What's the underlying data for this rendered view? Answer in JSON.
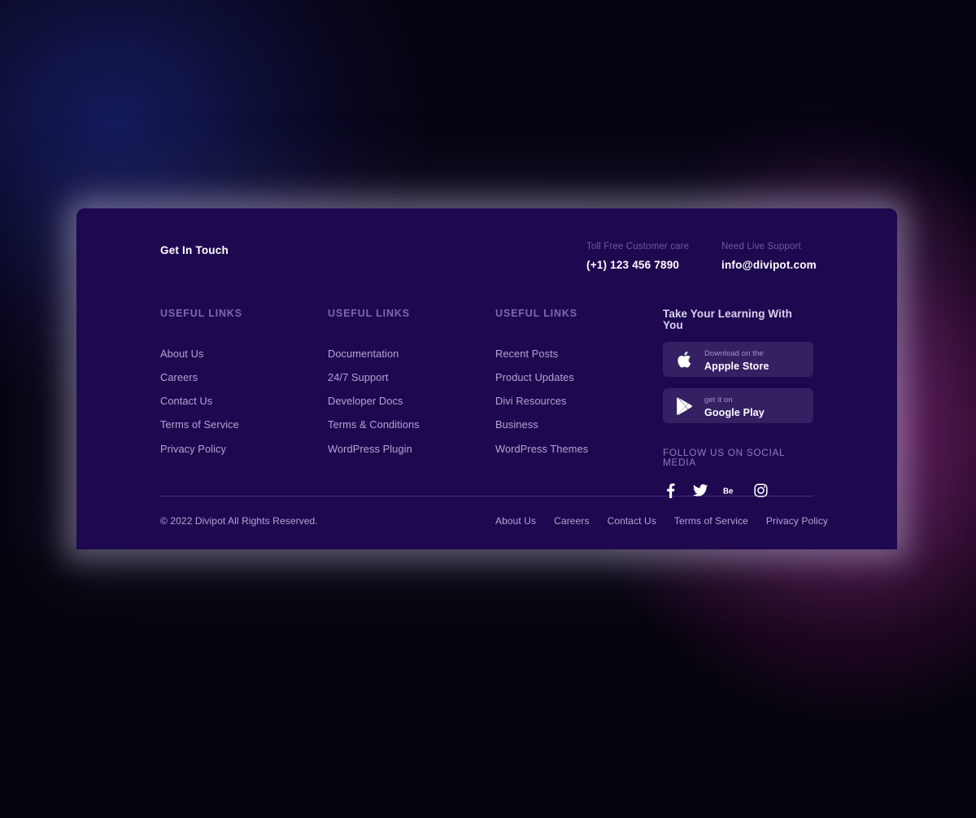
{
  "theme": {
    "card_background": "#1e0950",
    "page_background": "#060310",
    "link_color": "#b2a6d4",
    "heading_color": "#7a6aa6",
    "accent_button": "#352064",
    "glow_blue": "#161c60",
    "glow_magenta": "#7c1e6a"
  },
  "contact": {
    "heading": "Get In Touch",
    "phone_label": "Toll Free Customer care",
    "phone_value": "(+1) 123 456 7890",
    "email_label": "Need Live Support",
    "email_value": "info@divipot.com"
  },
  "columns": [
    {
      "title": "USEFUL LINKS",
      "links": [
        "About Us",
        "Careers",
        "Contact Us",
        "Terms of Service",
        "Privacy Policy"
      ]
    },
    {
      "title": "USEFUL LINKS",
      "links": [
        "Documentation",
        "24/7 Support",
        "Developer Docs",
        "Terms & Conditions",
        "WordPress Plugin"
      ]
    },
    {
      "title": "USEFUL LINKS",
      "links": [
        "Recent Posts",
        "Product Updates",
        "Divi Resources",
        "Business",
        "WordPress Themes"
      ]
    }
  ],
  "promo": {
    "title": "Take Your Learning With You",
    "stores": [
      {
        "icon": "apple-icon",
        "small": "Download on the",
        "big": "Appple Store"
      },
      {
        "icon": "google-play-icon",
        "small": "get it on",
        "big": "Google Play"
      }
    ],
    "social_title": "FOLLOW US ON SOCIAL MEDIA",
    "social": [
      {
        "icon": "facebook-icon",
        "name": "Facebook"
      },
      {
        "icon": "twitter-icon",
        "name": "Twitter"
      },
      {
        "icon": "behance-icon",
        "name": "Behance"
      },
      {
        "icon": "instagram-icon",
        "name": "Instagram"
      }
    ]
  },
  "bottom": {
    "copyright": "© 2022 Divipot All Rights Reserved.",
    "links": [
      "About Us",
      "Careers",
      "Contact Us",
      "Terms of Service",
      "Privacy Policy"
    ]
  }
}
